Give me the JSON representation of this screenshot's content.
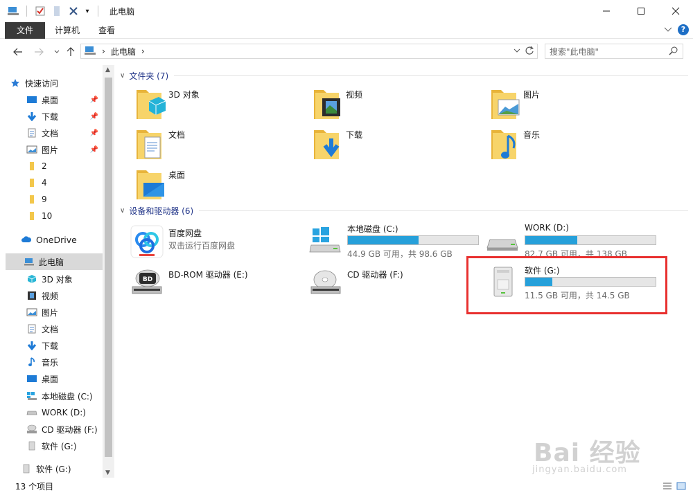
{
  "window": {
    "title": "此电脑",
    "qa_dropdown": "▾"
  },
  "ribbon": {
    "tabs": [
      "文件",
      "计算机",
      "查看"
    ],
    "help": "?"
  },
  "address": {
    "path": "此电脑",
    "separator": "›"
  },
  "search": {
    "placeholder": "搜索\"此电脑\""
  },
  "sidebar": {
    "quick_access": "快速访问",
    "quick_items": [
      "桌面",
      "下载",
      "文档",
      "图片",
      "2",
      "4",
      "9",
      "10"
    ],
    "onedrive": "OneDrive",
    "this_pc": "此电脑",
    "pc_items": [
      "3D 对象",
      "视频",
      "图片",
      "文档",
      "下载",
      "音乐",
      "桌面",
      "本地磁盘 (C:)",
      "WORK (D:)",
      "CD 驱动器 (F:)",
      "软件 (G:)"
    ],
    "extra_item": "软件 (G:)"
  },
  "folders_group": {
    "label": "文件夹 (7)",
    "items": [
      "3D 对象",
      "视频",
      "图片",
      "文档",
      "下载",
      "音乐",
      "桌面"
    ]
  },
  "devices_group": {
    "label": "设备和驱动器 (6)",
    "baidu": {
      "name": "百度网盘",
      "sub": "双击运行百度网盘"
    },
    "c": {
      "name": "本地磁盘 (C:)",
      "sub": "44.9 GB 可用，共 98.6 GB",
      "used_fraction": 0.545
    },
    "d": {
      "name": "WORK (D:)",
      "sub": "82.7 GB 可用，共 138 GB",
      "used_fraction": 0.4
    },
    "e": {
      "name": "BD-ROM 驱动器 (E:)",
      "badge": "BD"
    },
    "f": {
      "name": "CD 驱动器 (F:)"
    },
    "g": {
      "name": "软件 (G:)",
      "sub": "11.5 GB 可用，共 14.5 GB",
      "used_fraction": 0.207
    }
  },
  "status": {
    "count": "13 个项目"
  },
  "watermark": {
    "brand": "Bai 经验",
    "url": "jingyan.baidu.com"
  },
  "colors": {
    "accent": "#26a0da",
    "folder": "#f3c74b",
    "highlight": "#e8302f"
  }
}
